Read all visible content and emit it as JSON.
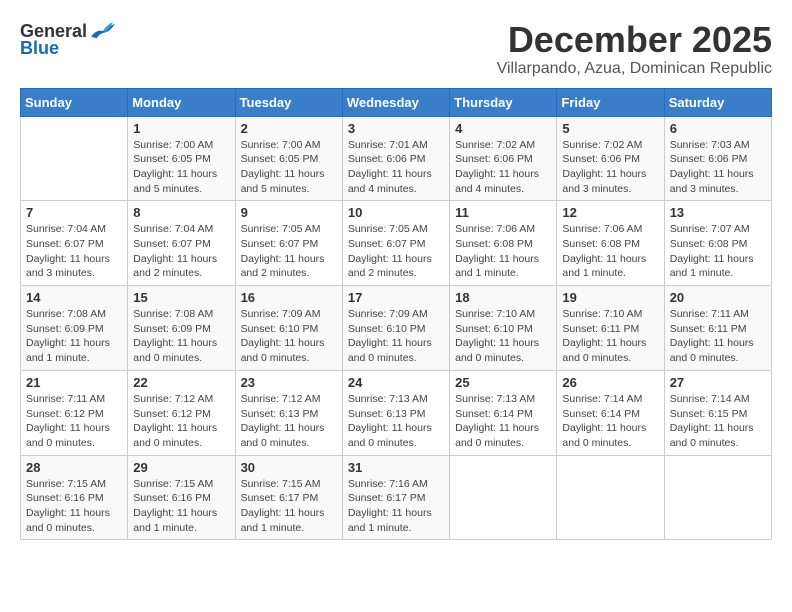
{
  "header": {
    "logo_general": "General",
    "logo_blue": "Blue",
    "month_title": "December 2025",
    "subtitle": "Villarpando, Azua, Dominican Republic"
  },
  "days_of_week": [
    "Sunday",
    "Monday",
    "Tuesday",
    "Wednesday",
    "Thursday",
    "Friday",
    "Saturday"
  ],
  "weeks": [
    [
      {
        "day": "",
        "info": ""
      },
      {
        "day": "1",
        "info": "Sunrise: 7:00 AM\nSunset: 6:05 PM\nDaylight: 11 hours\nand 5 minutes."
      },
      {
        "day": "2",
        "info": "Sunrise: 7:00 AM\nSunset: 6:05 PM\nDaylight: 11 hours\nand 5 minutes."
      },
      {
        "day": "3",
        "info": "Sunrise: 7:01 AM\nSunset: 6:06 PM\nDaylight: 11 hours\nand 4 minutes."
      },
      {
        "day": "4",
        "info": "Sunrise: 7:02 AM\nSunset: 6:06 PM\nDaylight: 11 hours\nand 4 minutes."
      },
      {
        "day": "5",
        "info": "Sunrise: 7:02 AM\nSunset: 6:06 PM\nDaylight: 11 hours\nand 3 minutes."
      },
      {
        "day": "6",
        "info": "Sunrise: 7:03 AM\nSunset: 6:06 PM\nDaylight: 11 hours\nand 3 minutes."
      }
    ],
    [
      {
        "day": "7",
        "info": "Sunrise: 7:04 AM\nSunset: 6:07 PM\nDaylight: 11 hours\nand 3 minutes."
      },
      {
        "day": "8",
        "info": "Sunrise: 7:04 AM\nSunset: 6:07 PM\nDaylight: 11 hours\nand 2 minutes."
      },
      {
        "day": "9",
        "info": "Sunrise: 7:05 AM\nSunset: 6:07 PM\nDaylight: 11 hours\nand 2 minutes."
      },
      {
        "day": "10",
        "info": "Sunrise: 7:05 AM\nSunset: 6:07 PM\nDaylight: 11 hours\nand 2 minutes."
      },
      {
        "day": "11",
        "info": "Sunrise: 7:06 AM\nSunset: 6:08 PM\nDaylight: 11 hours\nand 1 minute."
      },
      {
        "day": "12",
        "info": "Sunrise: 7:06 AM\nSunset: 6:08 PM\nDaylight: 11 hours\nand 1 minute."
      },
      {
        "day": "13",
        "info": "Sunrise: 7:07 AM\nSunset: 6:08 PM\nDaylight: 11 hours\nand 1 minute."
      }
    ],
    [
      {
        "day": "14",
        "info": "Sunrise: 7:08 AM\nSunset: 6:09 PM\nDaylight: 11 hours\nand 1 minute."
      },
      {
        "day": "15",
        "info": "Sunrise: 7:08 AM\nSunset: 6:09 PM\nDaylight: 11 hours\nand 0 minutes."
      },
      {
        "day": "16",
        "info": "Sunrise: 7:09 AM\nSunset: 6:10 PM\nDaylight: 11 hours\nand 0 minutes."
      },
      {
        "day": "17",
        "info": "Sunrise: 7:09 AM\nSunset: 6:10 PM\nDaylight: 11 hours\nand 0 minutes."
      },
      {
        "day": "18",
        "info": "Sunrise: 7:10 AM\nSunset: 6:10 PM\nDaylight: 11 hours\nand 0 minutes."
      },
      {
        "day": "19",
        "info": "Sunrise: 7:10 AM\nSunset: 6:11 PM\nDaylight: 11 hours\nand 0 minutes."
      },
      {
        "day": "20",
        "info": "Sunrise: 7:11 AM\nSunset: 6:11 PM\nDaylight: 11 hours\nand 0 minutes."
      }
    ],
    [
      {
        "day": "21",
        "info": "Sunrise: 7:11 AM\nSunset: 6:12 PM\nDaylight: 11 hours\nand 0 minutes."
      },
      {
        "day": "22",
        "info": "Sunrise: 7:12 AM\nSunset: 6:12 PM\nDaylight: 11 hours\nand 0 minutes."
      },
      {
        "day": "23",
        "info": "Sunrise: 7:12 AM\nSunset: 6:13 PM\nDaylight: 11 hours\nand 0 minutes."
      },
      {
        "day": "24",
        "info": "Sunrise: 7:13 AM\nSunset: 6:13 PM\nDaylight: 11 hours\nand 0 minutes."
      },
      {
        "day": "25",
        "info": "Sunrise: 7:13 AM\nSunset: 6:14 PM\nDaylight: 11 hours\nand 0 minutes."
      },
      {
        "day": "26",
        "info": "Sunrise: 7:14 AM\nSunset: 6:14 PM\nDaylight: 11 hours\nand 0 minutes."
      },
      {
        "day": "27",
        "info": "Sunrise: 7:14 AM\nSunset: 6:15 PM\nDaylight: 11 hours\nand 0 minutes."
      }
    ],
    [
      {
        "day": "28",
        "info": "Sunrise: 7:15 AM\nSunset: 6:16 PM\nDaylight: 11 hours\nand 0 minutes."
      },
      {
        "day": "29",
        "info": "Sunrise: 7:15 AM\nSunset: 6:16 PM\nDaylight: 11 hours\nand 1 minute."
      },
      {
        "day": "30",
        "info": "Sunrise: 7:15 AM\nSunset: 6:17 PM\nDaylight: 11 hours\nand 1 minute."
      },
      {
        "day": "31",
        "info": "Sunrise: 7:16 AM\nSunset: 6:17 PM\nDaylight: 11 hours\nand 1 minute."
      },
      {
        "day": "",
        "info": ""
      },
      {
        "day": "",
        "info": ""
      },
      {
        "day": "",
        "info": ""
      }
    ]
  ]
}
